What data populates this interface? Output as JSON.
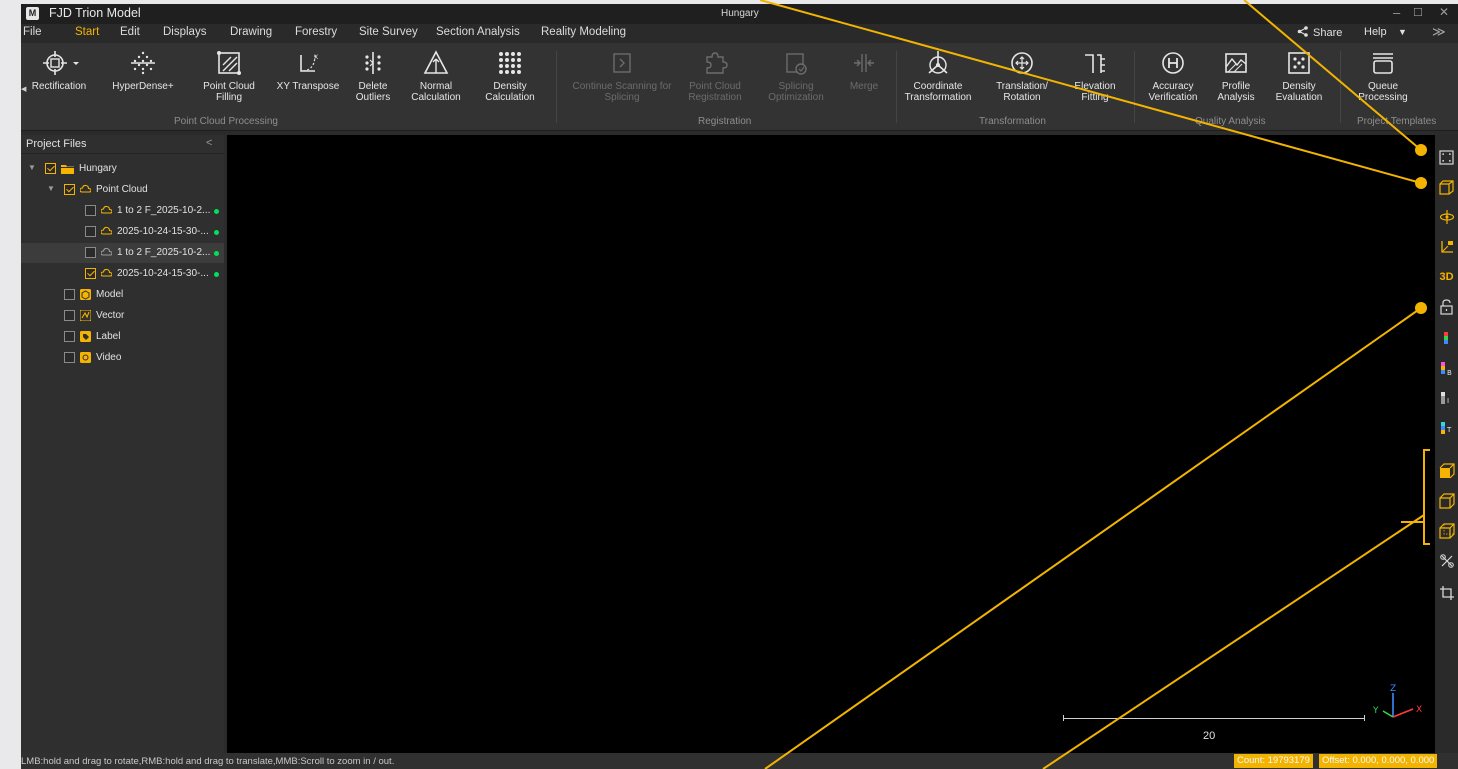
{
  "window": {
    "app_title": "FJD Trion Model",
    "project_title": "Hungary",
    "logo_glyph": "M",
    "controls": [
      "–",
      "☐",
      "✕"
    ]
  },
  "menu": {
    "items": [
      "File",
      "Start",
      "Edit",
      "Displays",
      "Drawing",
      "Forestry",
      "Site Survey",
      "Section Analysis",
      "Reality Modeling"
    ],
    "active": "Start",
    "share_label": "Share",
    "help_label": "Help"
  },
  "ribbon": {
    "groups": {
      "point_cloud_processing": "Point Cloud Processing",
      "registration": "Registration",
      "transformation": "Transformation",
      "quality_analysis": "Quality Analysis",
      "project_templates": "Project Templates"
    },
    "tools": {
      "rectification": "Rectification",
      "hyperdense": "HyperDense+",
      "point_cloud_filling": "Point Cloud\nFilling",
      "xy_transpose": "XY Transpose",
      "delete_outliers": "Delete\nOutliers",
      "normal_calculation": "Normal\nCalculation",
      "density_calculation": "Density\nCalculation",
      "continue_scanning": "Continue Scanning for\nSplicing",
      "point_cloud_registration": "Point Cloud\nRegistration",
      "splicing_optimization": "Splicing\nOptimization",
      "merge": "Merge",
      "coordinate_transformation": "Coordinate\nTransformation",
      "translation_rotation": "Translation/\nRotation",
      "elevation_fitting": "Elevation\nFitting",
      "accuracy_verification": "Accuracy\nVerification",
      "profile_analysis": "Profile\nAnalysis",
      "density_evaluation": "Density\nEvaluation",
      "queue_processing": "Queue\nProcessing"
    }
  },
  "project_panel": {
    "title": "Project Files",
    "tree": {
      "root": {
        "label": "Hungary",
        "checked": true
      },
      "point_cloud": {
        "label": "Point Cloud",
        "checked": true
      },
      "scans": [
        {
          "label": "1 to 2 F_2025-10-2...",
          "checked": false,
          "status": "loaded"
        },
        {
          "label": "2025-10-24-15-30-...",
          "checked": false,
          "status": "loaded"
        },
        {
          "label": "1 to 2 F_2025-10-2...",
          "checked": false,
          "status": "loaded"
        },
        {
          "label": "2025-10-24-15-30-...",
          "checked": true,
          "status": "loaded"
        }
      ],
      "model": {
        "label": "Model",
        "checked": false
      },
      "vector": {
        "label": "Vector",
        "checked": false
      },
      "label": {
        "label": "Label",
        "checked": false
      },
      "video": {
        "label": "Video",
        "checked": false
      }
    }
  },
  "viewport": {
    "scale_value": "20",
    "axis_labels": {
      "z": "Z",
      "y": "Y",
      "x": "X"
    }
  },
  "right_toolbar": {
    "tools": [
      "fit-view-icon",
      "bounding-box-icon",
      "orbit-center-icon",
      "coordinate-axes-icon",
      "3d-view-icon",
      "unlock-icon",
      "color-rgb-icon",
      "color-by-elevation-icon",
      "color-by-intensity-icon",
      "color-by-time-icon",
      "perspective-view-icon",
      "top-view-icon",
      "front-view-icon",
      "clear-icon",
      "crop-icon"
    ],
    "label_3d": "3D",
    "color_b": "B",
    "color_i": "I",
    "color_t": "T"
  },
  "status": {
    "message": "LMB:hold and drag to rotate,RMB:hold and drag to translate,MMB:Scroll to zoom in / out.",
    "count": "Count: 19793179",
    "offset": "Offset: 0.000, 0.000, 0.000"
  },
  "colors": {
    "accent": "#f4b400",
    "callout": "#f2b400",
    "status_dot": "#00e05a",
    "viewport_bg": "#000000"
  }
}
